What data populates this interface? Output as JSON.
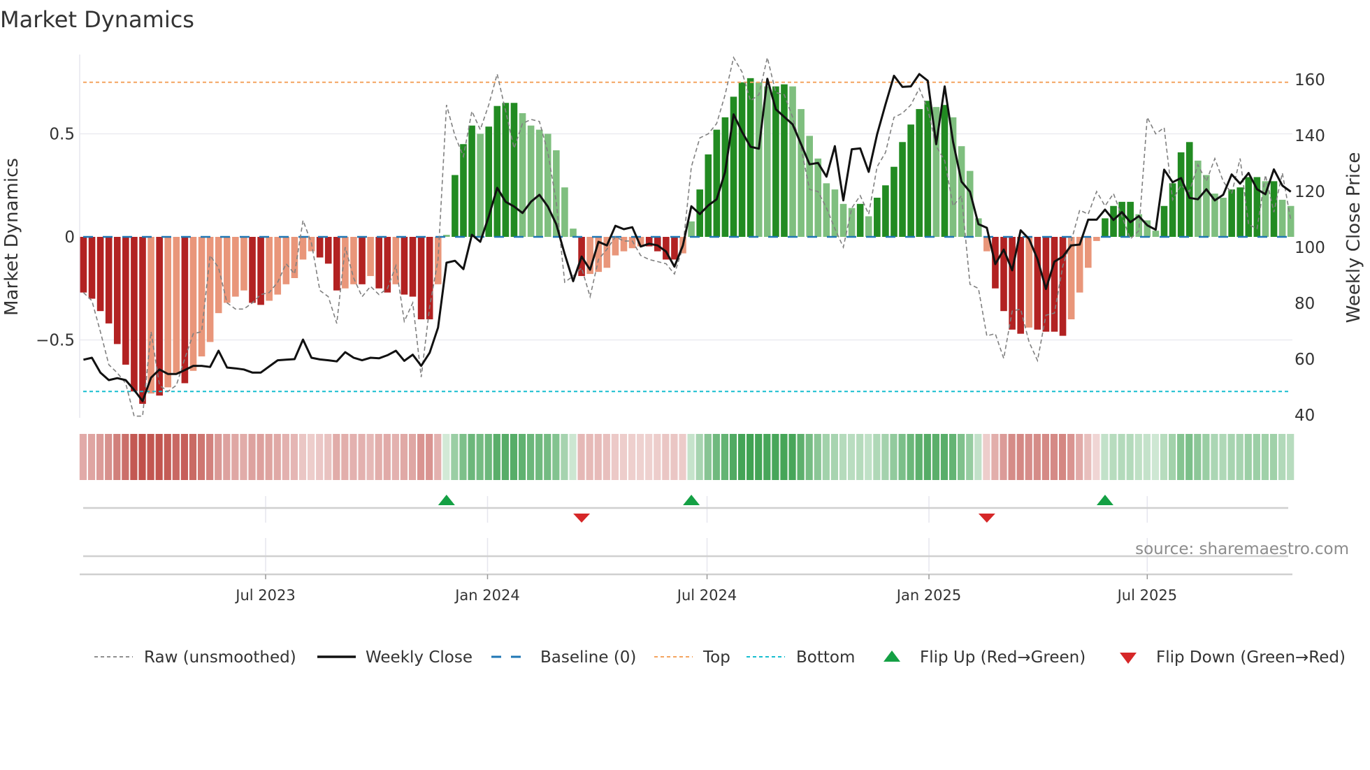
{
  "chart_data": {
    "type": "bar",
    "title": "Market Dynamics",
    "ylabel": "Market Dynamics",
    "y2label": "Weekly Close Price",
    "ylim": [
      -0.88,
      0.88
    ],
    "y2lim": [
      40,
      166
    ],
    "yticks": [
      {
        "v": 0.5,
        "label": "0.5"
      },
      {
        "v": 0,
        "label": "0"
      },
      {
        "v": -0.5,
        "label": "−0.5"
      }
    ],
    "y2ticks": [
      {
        "v": 160,
        "label": "160"
      },
      {
        "v": 140,
        "label": "140"
      },
      {
        "v": 120,
        "label": "120"
      },
      {
        "v": 100,
        "label": "100"
      },
      {
        "v": 80,
        "label": "80"
      },
      {
        "v": 60,
        "label": "60"
      },
      {
        "v": 40,
        "label": "40"
      }
    ],
    "xticks": [
      {
        "date": "2023-07-01",
        "label": "Jul 2023"
      },
      {
        "date": "2024-01-01",
        "label": "Jan 2024"
      },
      {
        "date": "2024-07-01",
        "label": "Jul 2024"
      },
      {
        "date": "2025-01-01",
        "label": "Jan 2025"
      },
      {
        "date": "2025-07-01",
        "label": "Jul 2025"
      }
    ],
    "frequency": "weekly",
    "start_date": "2023-01-31",
    "thresholds": {
      "top": 0.75,
      "bottom": -0.75,
      "baseline": 0
    },
    "series": [
      {
        "name": "Market Dynamics (smoothed)",
        "values": [
          -0.27,
          -0.3,
          -0.36,
          -0.42,
          -0.52,
          -0.62,
          -0.75,
          -0.81,
          -0.76,
          -0.77,
          -0.73,
          -0.66,
          -0.71,
          -0.65,
          -0.58,
          -0.51,
          -0.37,
          -0.32,
          -0.29,
          -0.26,
          -0.32,
          -0.33,
          -0.31,
          -0.28,
          -0.23,
          -0.2,
          -0.11,
          -0.07,
          -0.1,
          -0.13,
          -0.26,
          -0.25,
          -0.23,
          -0.23,
          -0.19,
          -0.25,
          -0.27,
          -0.23,
          -0.28,
          -0.29,
          -0.4,
          -0.4,
          -0.23,
          0.01,
          0.3,
          0.45,
          0.54,
          0.5,
          0.535,
          0.635,
          0.65,
          0.65,
          0.6,
          0.54,
          0.52,
          0.5,
          0.42,
          0.24,
          0.04,
          -0.19,
          -0.18,
          -0.17,
          -0.15,
          -0.09,
          -0.07,
          -0.055,
          -0.046,
          -0.046,
          -0.07,
          -0.11,
          -0.11,
          -0.08,
          0.075,
          0.23,
          0.4,
          0.52,
          0.58,
          0.68,
          0.75,
          0.77,
          0.75,
          0.73,
          0.73,
          0.74,
          0.73,
          0.62,
          0.49,
          0.38,
          0.26,
          0.23,
          0.16,
          0.14,
          0.16,
          0.1,
          0.19,
          0.25,
          0.34,
          0.46,
          0.545,
          0.62,
          0.66,
          0.63,
          0.64,
          0.58,
          0.44,
          0.32,
          0.09,
          -0.07,
          -0.25,
          -0.36,
          -0.45,
          -0.47,
          -0.44,
          -0.45,
          -0.46,
          -0.46,
          -0.48,
          -0.4,
          -0.27,
          -0.15,
          -0.02,
          0.09,
          0.15,
          0.17,
          0.17,
          0.11,
          0.08,
          0.03,
          0.15,
          0.26,
          0.41,
          0.46,
          0.37,
          0.3,
          0.21,
          0.19,
          0.23,
          0.24,
          0.29,
          0.29,
          0.27,
          0.27,
          0.18,
          0.15
        ]
      },
      {
        "name": "Raw (unsmoothed)",
        "values": [
          -0.27,
          -0.31,
          -0.46,
          -0.62,
          -0.66,
          -0.71,
          -0.87,
          -0.87,
          -0.46,
          -0.72,
          -0.75,
          -0.72,
          -0.59,
          -0.47,
          -0.46,
          -0.09,
          -0.15,
          -0.32,
          -0.35,
          -0.35,
          -0.32,
          -0.28,
          -0.27,
          -0.22,
          -0.13,
          -0.18,
          0.08,
          -0.03,
          -0.26,
          -0.29,
          -0.42,
          -0.05,
          -0.2,
          -0.29,
          -0.24,
          -0.28,
          -0.25,
          -0.14,
          -0.41,
          -0.32,
          -0.68,
          -0.34,
          -0.11,
          0.64,
          0.49,
          0.39,
          0.61,
          0.52,
          0.64,
          0.79,
          0.61,
          0.43,
          0.55,
          0.57,
          0.56,
          0.41,
          0.17,
          -0.22,
          -0.19,
          -0.15,
          -0.29,
          -0.11,
          -0.06,
          0.0,
          -0.02,
          -0.02,
          -0.09,
          -0.11,
          -0.12,
          -0.13,
          -0.18,
          -0.05,
          0.34,
          0.48,
          0.5,
          0.55,
          0.69,
          0.87,
          0.8,
          0.66,
          0.69,
          0.87,
          0.7,
          0.69,
          0.58,
          0.43,
          0.23,
          0.22,
          0.14,
          0.04,
          -0.05,
          0.14,
          0.2,
          0.11,
          0.34,
          0.41,
          0.58,
          0.6,
          0.64,
          0.72,
          0.62,
          0.44,
          0.37,
          0.15,
          0.2,
          -0.23,
          -0.25,
          -0.48,
          -0.47,
          -0.59,
          -0.36,
          -0.35,
          -0.51,
          -0.6,
          -0.38,
          -0.37,
          -0.14,
          -0.02,
          0.13,
          0.11,
          0.22,
          0.15,
          0.21,
          0.1,
          -0.01,
          0.03,
          0.58,
          0.5,
          0.53,
          0.18,
          0.25,
          0.22,
          0.35,
          0.27,
          0.38,
          0.27,
          0.21,
          0.38,
          0.06,
          0.04,
          0.3,
          0.12,
          0.31,
          0.08
        ]
      },
      {
        "name": "Weekly Close",
        "axis": "right",
        "values": [
          59.8,
          60.5,
          55.2,
          52.5,
          53.2,
          52.5,
          49,
          45,
          53.4,
          56.3,
          54.7,
          54.7,
          56.1,
          57.6,
          57.6,
          57.2,
          63,
          57,
          56.7,
          56.3,
          55.2,
          55.2,
          57.4,
          59.6,
          59.8,
          60,
          67,
          60.5,
          59.9,
          59.6,
          59.2,
          62.5,
          60.5,
          59.6,
          60.5,
          60.3,
          61.4,
          63,
          59.4,
          61.6,
          57.6,
          62.3,
          71.3,
          94.5,
          95.2,
          92.2,
          104.5,
          102,
          111,
          121.3,
          116.3,
          114.6,
          112.3,
          116.3,
          118.8,
          114.6,
          108.3,
          97.6,
          87.9,
          96.7,
          92,
          102,
          100.7,
          107.7,
          106.5,
          107.2,
          100.3,
          101.3,
          100.7,
          98.5,
          93.1,
          100.7,
          114.7,
          111.9,
          115,
          117.2,
          127,
          147.6,
          141.3,
          136,
          135.3,
          160.3,
          149.4,
          146.7,
          144,
          136.9,
          129.7,
          130.2,
          125.3,
          136.2,
          116.8,
          135.1,
          135.4,
          127,
          140.4,
          151.2,
          161.4,
          157.4,
          157.6,
          162,
          159.6,
          136.9,
          157.6,
          137.8,
          123.5,
          119.9,
          108.3,
          107,
          94,
          99.2,
          91.8,
          106.1,
          103,
          95.8,
          85.1,
          94.9,
          96.7,
          100.7,
          101,
          109.9,
          109.9,
          113.5,
          109.8,
          112.6,
          109,
          111.2,
          107.9,
          106.3,
          127.8,
          123.3,
          124.8,
          117.7,
          117.2,
          120.8,
          116.8,
          118.8,
          126.1,
          122.8,
          126.6,
          120.8,
          119,
          127.9,
          122.1,
          119.9
        ]
      }
    ],
    "legend": {
      "placement": "bottom",
      "items": [
        "Raw (unsmoothed)",
        "Weekly Close",
        "Baseline (0)",
        "Top",
        "Bottom",
        "Flip Up (Red→Green)",
        "Flip Down (Green→Red)"
      ]
    },
    "annotation": "source: sharemaestro.com",
    "colors": {
      "pos_strong": "#228b22",
      "pos_weak": "#7fbf7f",
      "neg_strong": "#b22222",
      "neg_weak": "#e9967a",
      "baseline": "#1f77b4",
      "top": "#f4a460",
      "bottom": "#17becf",
      "raw": "#808080",
      "close": "#111111",
      "flip_up": "#14a044",
      "flip_down": "#d62728"
    }
  }
}
